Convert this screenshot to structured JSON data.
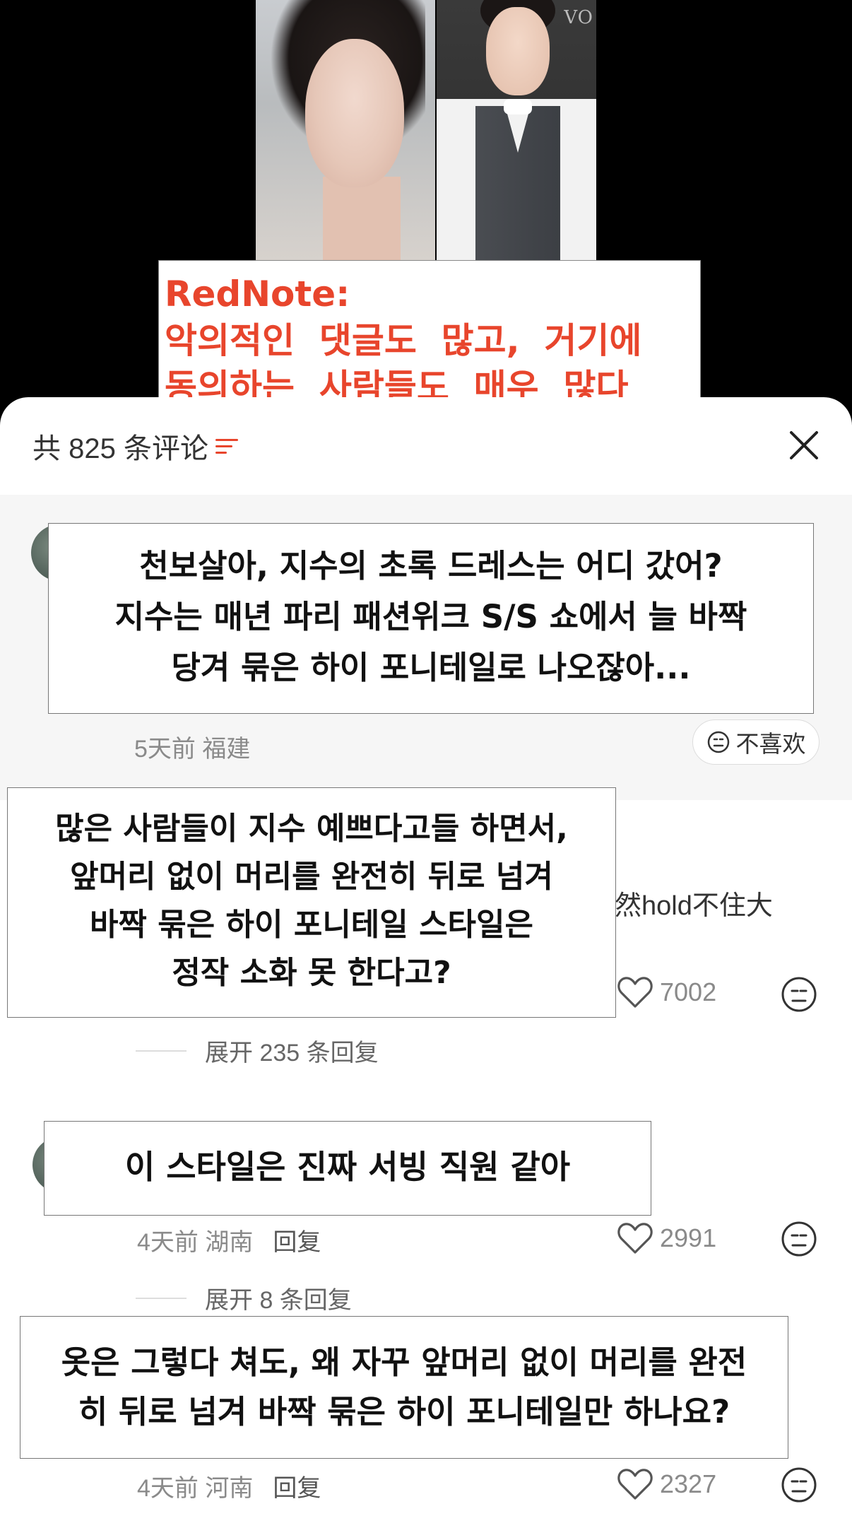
{
  "photos": {
    "watermark": "VO"
  },
  "caption": {
    "line1": "RedNote:",
    "line2": "악의적인  댓글도  많고,  거기에",
    "line3": "동의하는  사람들도  매우  많다"
  },
  "header": {
    "count_label": "共 825 条评论"
  },
  "comments": [
    {
      "text": [
        "천보살아, 지수의 초록 드레스는 어디 갔어?",
        "지수는 매년 파리 패션위크 S/S 쇼에서 늘 바짝",
        "당겨 묶은 하이 포니테일로 나오잖아..."
      ],
      "time": "5天前",
      "location": "福建",
      "dislike_label": "不喜欢"
    },
    {
      "text": [
        "많은 사람들이 지수 예쁘다고들 하면서,",
        "앞머리 없이 머리를 완전히 뒤로 넘겨",
        "바짝 묶은 하이 포니테일 스타일은",
        "정작 소화 못 한다고?"
      ],
      "partial_text": "然hold不住大",
      "likes": "7002",
      "expand_label": "展开 235 条回复"
    },
    {
      "text": [
        "이 스타일은 진짜 서빙 직원 같아"
      ],
      "time": "4天前",
      "location": "湖南",
      "reply_label": "回复",
      "likes": "2991",
      "expand_label": "展开 8 条回复"
    },
    {
      "text": [
        "옷은 그렇다 쳐도, 왜 자꾸 앞머리 없이 머리를 완전",
        "히 뒤로 넘겨 바짝 묶은 하이 포니테일만 하나요?"
      ],
      "time": "4天前",
      "location": "河南",
      "reply_label": "回复",
      "likes": "2327"
    }
  ],
  "colors": {
    "accent": "#e8452c",
    "meta": "#8a8a8a"
  }
}
